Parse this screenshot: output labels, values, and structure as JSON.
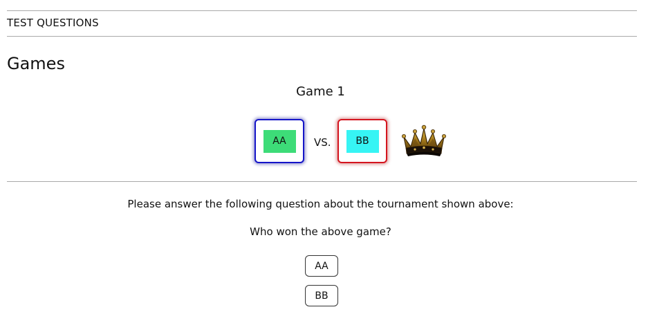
{
  "header": {
    "section_label": "TEST QUESTIONS"
  },
  "page": {
    "title": "Games"
  },
  "game": {
    "title": "Game 1",
    "team_a": {
      "label": "AA",
      "border_color": "#1414c8",
      "chip_color": "#3ddc78"
    },
    "vs_label": "VS.",
    "team_b": {
      "label": "BB",
      "border_color": "#d4141e",
      "chip_color": "#36f4f4"
    },
    "winner_icon": "crown-icon"
  },
  "question": {
    "prompt": "Please answer the following question about the tournament shown above:",
    "text": "Who won the above game?",
    "options": [
      "AA",
      "BB"
    ]
  }
}
